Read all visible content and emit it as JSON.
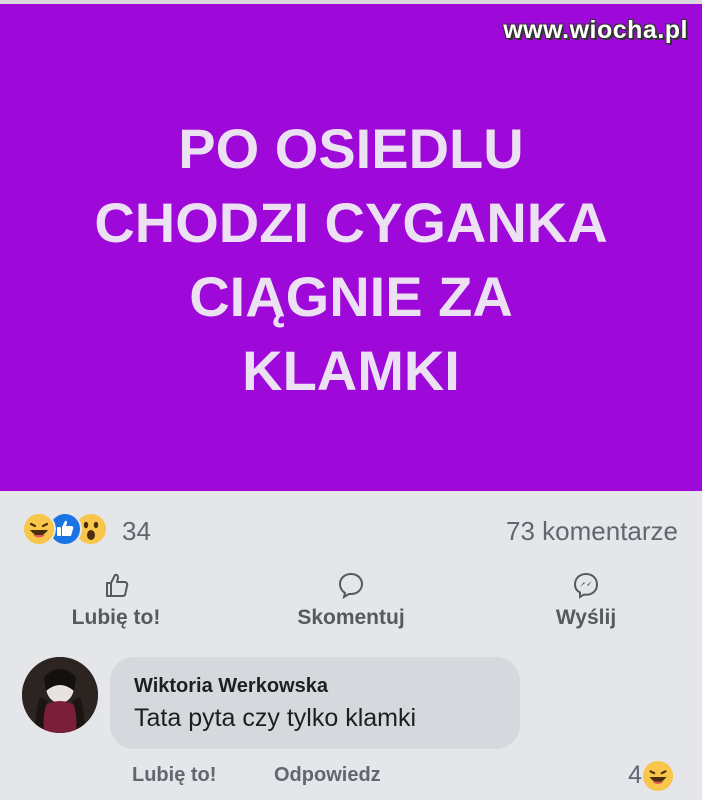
{
  "watermark": "www.wiocha.pl",
  "post": {
    "text_lines": [
      "PO OSIEDLU",
      "CHODZI CYGANKA",
      "CIĄGNIE ZA",
      "KLAMKI"
    ],
    "background_color": "#9e08d8"
  },
  "reactions": {
    "icons": [
      "laugh-emoji-icon",
      "like-thumb-icon",
      "wow-emoji-icon"
    ],
    "count": "34"
  },
  "comments_count": "73 komentarze",
  "actions": {
    "like_label": "Lubię to!",
    "comment_label": "Skomentuj",
    "send_label": "Wyślij"
  },
  "comment": {
    "author": "Wiktoria Werkowska",
    "text": "Tata pyta czy tylko klamki",
    "like_label": "Lubię to!",
    "reply_label": "Odpowiedz",
    "reaction_count": "4",
    "reaction_icon": "laugh-emoji-icon"
  }
}
